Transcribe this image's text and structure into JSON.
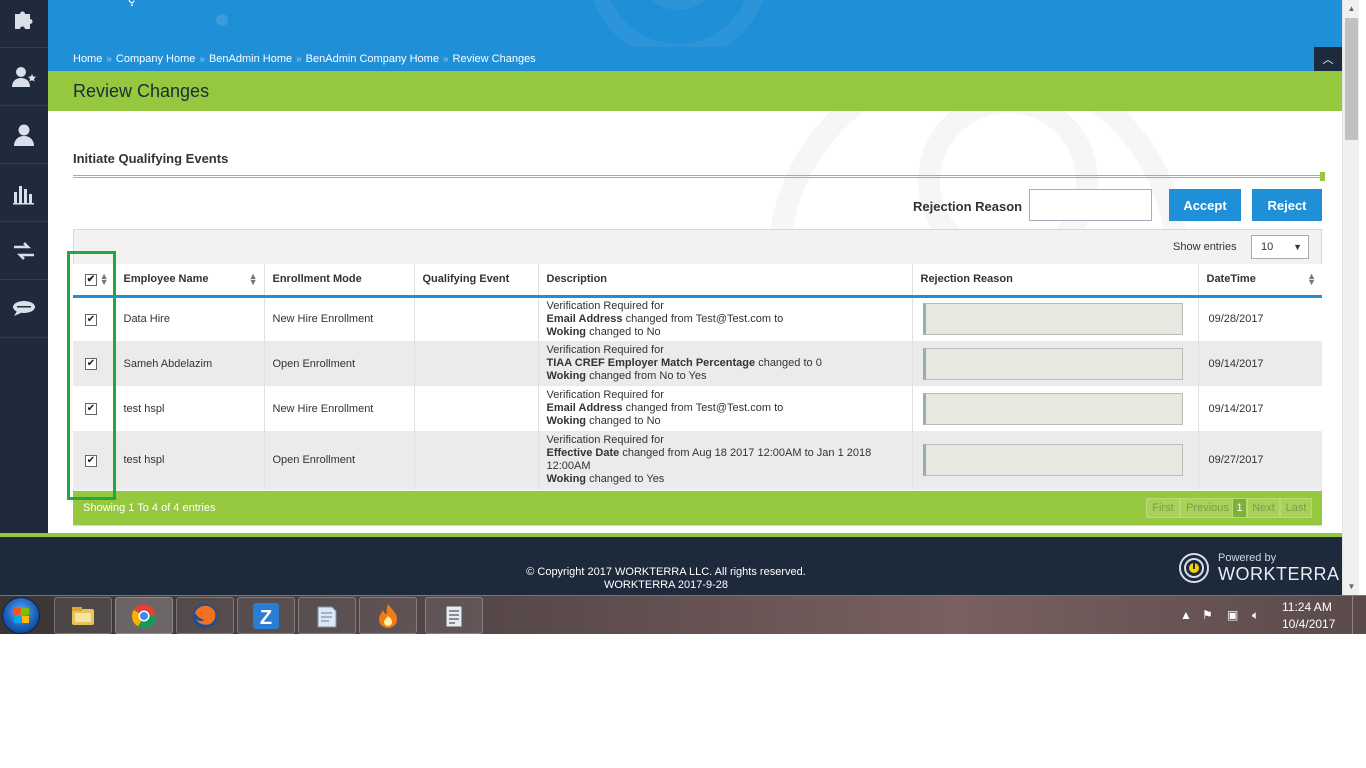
{
  "breadcrumb": [
    "Home",
    "Company Home",
    "BenAdmin Home",
    "BenAdmin Company Home",
    "Review Changes"
  ],
  "page_title": "Review Changes",
  "section_title": "Initiate Qualifying Events",
  "rejection_reason_label": "Rejection Reason",
  "rejection_reason_value": "",
  "accept_label": "Accept",
  "reject_label": "Reject",
  "show_entries_label": "Show entries",
  "show_entries_value": "10",
  "table": {
    "headers": [
      "Employee Name",
      "Enrollment Mode",
      "Qualifying Event",
      "Description",
      "Rejection Reason",
      "DateTime"
    ],
    "rows": [
      {
        "checked": true,
        "name": "Data Hire",
        "mode": "New Hire Enrollment",
        "event": "",
        "desc": [
          {
            "t": "Verification Required for",
            "b": ""
          },
          {
            "b": "Email Address",
            "t": " changed from Test@Test.com to"
          },
          {
            "b": "Woking",
            "t": " changed to No"
          }
        ],
        "date": "09/28/2017"
      },
      {
        "checked": true,
        "name": "Sameh Abdelazim",
        "mode": "Open Enrollment",
        "event": "",
        "desc": [
          {
            "t": "Verification Required for",
            "b": ""
          },
          {
            "b": "TIAA CREF Employer Match Percentage",
            "t": " changed to 0"
          },
          {
            "b": "Woking",
            "t": " changed from No to Yes"
          }
        ],
        "date": "09/14/2017"
      },
      {
        "checked": true,
        "name": "test hspl",
        "mode": "New Hire Enrollment",
        "event": "",
        "desc": [
          {
            "t": "Verification Required for",
            "b": ""
          },
          {
            "b": "Email Address",
            "t": " changed from Test@Test.com to"
          },
          {
            "b": "Woking",
            "t": " changed to No"
          }
        ],
        "date": "09/14/2017"
      },
      {
        "checked": true,
        "name": "test hspl",
        "mode": "Open Enrollment",
        "event": "",
        "desc": [
          {
            "t": "Verification Required for",
            "b": ""
          },
          {
            "b": "Effective Date",
            "t": " changed from Aug 18 2017 12:00AM to Jan 1 2018 12:00AM"
          },
          {
            "b": "Woking",
            "t": " changed to Yes"
          }
        ],
        "date": "09/27/2017"
      }
    ]
  },
  "showing_text": "Showing 1 To 4 of 4 entries",
  "pagination": [
    "First",
    "Previous",
    "1",
    "Next",
    "Last"
  ],
  "footer": {
    "copyright": "© Copyright 2017 WORKTERRA LLC. All rights reserved.",
    "version": "WORKTERRA 2017-9-28",
    "powered_by": "Powered by",
    "brand": "WORKTERRA"
  },
  "taskbar": {
    "time": "11:24 AM",
    "date": "10/4/2017",
    "apps": [
      "windows-explorer",
      "chrome",
      "firefox",
      "z-app",
      "notepad",
      "flame-app",
      "document-app"
    ]
  },
  "colors": {
    "header_blue": "#1f8fd8",
    "accent_green": "#96c83f",
    "sidebar_navy": "#1f2b3d",
    "highlight_green": "#21a845"
  }
}
